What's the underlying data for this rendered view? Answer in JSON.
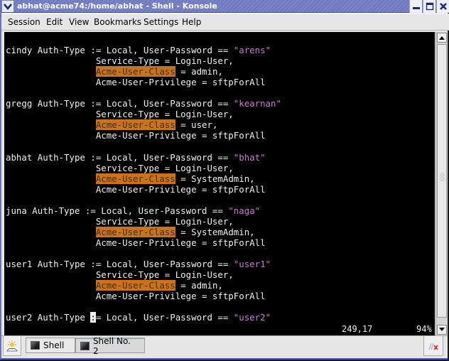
{
  "window": {
    "title": "abhat@acme74:/home/abhat - Shell - Konsole",
    "accent_color": "#6f77be"
  },
  "menubar": {
    "items": [
      "Session",
      "Edit",
      "View",
      "Bookmarks",
      "Settings",
      "Help"
    ]
  },
  "terminal": {
    "lines": [
      {
        "parts": [
          {
            "t": "cindy Auth-Type := Local, User-Password == "
          },
          {
            "t": "\"arens\"",
            "c": "str"
          }
        ]
      },
      {
        "parts": [
          {
            "t": "                 Service-Type = Login-User,"
          }
        ]
      },
      {
        "parts": [
          {
            "t": "                 "
          },
          {
            "t": "Acme-User-Class",
            "c": "hl"
          },
          {
            "t": " = admin,"
          }
        ]
      },
      {
        "parts": [
          {
            "t": "                 Acme-User-Privilege = sftpForAll"
          }
        ]
      },
      {
        "parts": [
          {
            "t": ""
          }
        ]
      },
      {
        "parts": [
          {
            "t": "gregg Auth-Type := Local, User-Password == "
          },
          {
            "t": "\"kearnan\"",
            "c": "str"
          }
        ]
      },
      {
        "parts": [
          {
            "t": "                 Service-Type = Login-User,"
          }
        ]
      },
      {
        "parts": [
          {
            "t": "                 "
          },
          {
            "t": "Acme-User-Class",
            "c": "hl"
          },
          {
            "t": " = user,"
          }
        ]
      },
      {
        "parts": [
          {
            "t": "                 Acme-User-Privilege = sftpForAll"
          }
        ]
      },
      {
        "parts": [
          {
            "t": ""
          }
        ]
      },
      {
        "parts": [
          {
            "t": "abhat Auth-Type := Local, User-Password == "
          },
          {
            "t": "\"bhat\"",
            "c": "str"
          }
        ]
      },
      {
        "parts": [
          {
            "t": "                 Service-Type = Login-User,"
          }
        ]
      },
      {
        "parts": [
          {
            "t": "                 "
          },
          {
            "t": "Acme-User-Class",
            "c": "hl"
          },
          {
            "t": " = SystemAdmin,"
          }
        ]
      },
      {
        "parts": [
          {
            "t": "                 Acme-User-Privilege = sftpForAll"
          }
        ]
      },
      {
        "parts": [
          {
            "t": ""
          }
        ]
      },
      {
        "parts": [
          {
            "t": "juna Auth-Type := Local, User-Password == "
          },
          {
            "t": "\"naga\"",
            "c": "str"
          }
        ]
      },
      {
        "parts": [
          {
            "t": "                 Service-Type = Login-User,"
          }
        ]
      },
      {
        "parts": [
          {
            "t": "                 "
          },
          {
            "t": "Acme-User-Class",
            "c": "hl"
          },
          {
            "t": " = SystemAdmin,"
          }
        ]
      },
      {
        "parts": [
          {
            "t": "                 Acme-User-Privilege = sftpForAll"
          }
        ]
      },
      {
        "parts": [
          {
            "t": ""
          }
        ]
      },
      {
        "parts": [
          {
            "t": "user1 Auth-Type := Local, User-Password == "
          },
          {
            "t": "\"user1\"",
            "c": "str"
          }
        ]
      },
      {
        "parts": [
          {
            "t": "                 Service-Type = Login-User,"
          }
        ]
      },
      {
        "parts": [
          {
            "t": "                 "
          },
          {
            "t": "Acme-User-Class",
            "c": "hl"
          },
          {
            "t": " = admin,"
          }
        ]
      },
      {
        "parts": [
          {
            "t": "                 Acme-User-Privilege = sftpForAll"
          }
        ]
      },
      {
        "parts": [
          {
            "t": ""
          }
        ]
      },
      {
        "parts": [
          {
            "t": "user2 Auth-Type "
          },
          {
            "t": ":",
            "c": "cursor"
          },
          {
            "t": "= Local, User-Password == "
          },
          {
            "t": "\"user2\"",
            "c": "str"
          }
        ]
      }
    ],
    "status_position": "249,17",
    "status_percent": "94%",
    "highlight_color": "#c8741e",
    "string_color": "#c87ad2"
  },
  "scrollbar": {
    "position_percent": 94
  },
  "tabs": [
    {
      "label": "Shell",
      "active": false
    },
    {
      "label": "Shell No. 2",
      "active": true
    }
  ]
}
